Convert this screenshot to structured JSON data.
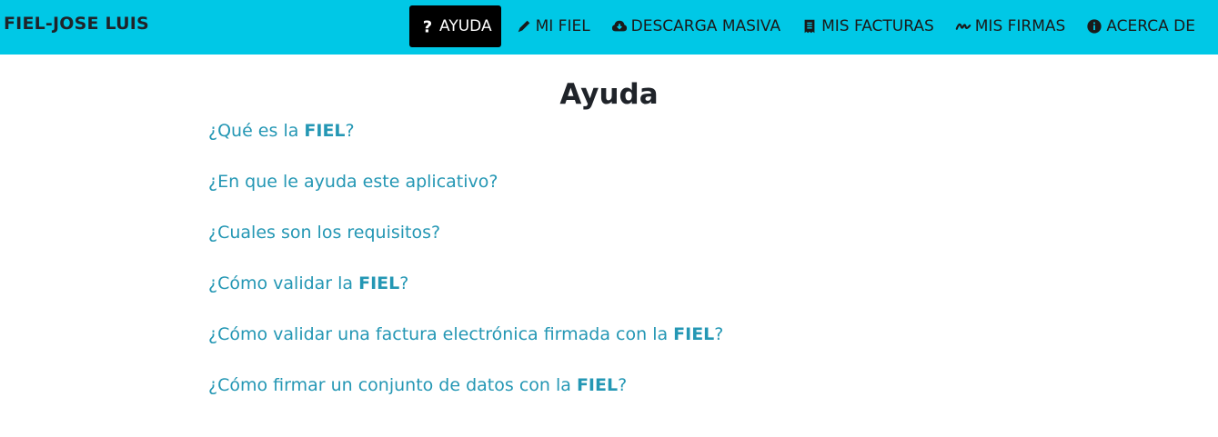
{
  "brand": "FIEL-JOSE LUIS",
  "nav": {
    "items": [
      {
        "label": "AYUDA",
        "icon": "question-icon"
      },
      {
        "label": "MI FIEL",
        "icon": "pen-icon"
      },
      {
        "label": "DESCARGA MASIVA",
        "icon": "cloud-download-icon"
      },
      {
        "label": "MIS FACTURAS",
        "icon": "receipt-icon"
      },
      {
        "label": "MIS FIRMAS",
        "icon": "signature-icon"
      },
      {
        "label": "ACERCA DE",
        "icon": "info-icon"
      }
    ],
    "active": "AYUDA"
  },
  "page_title": "Ayuda",
  "faq": [
    {
      "pre": "¿Qué es la ",
      "bold": "FIEL",
      "post": "?"
    },
    {
      "pre": "¿En que le ayuda este aplicativo?",
      "bold": "",
      "post": ""
    },
    {
      "pre": "¿Cuales son los requisitos?",
      "bold": "",
      "post": ""
    },
    {
      "pre": "¿Cómo validar la ",
      "bold": "FIEL",
      "post": "?"
    },
    {
      "pre": "¿Cómo validar una factura electrónica firmada con la ",
      "bold": "FIEL",
      "post": "?"
    },
    {
      "pre": "¿Cómo firmar un conjunto de datos con la ",
      "bold": "FIEL",
      "post": "?"
    }
  ],
  "colors": {
    "navbar": "#00c8e6",
    "link": "#2497b4",
    "active_bg": "#000000"
  }
}
